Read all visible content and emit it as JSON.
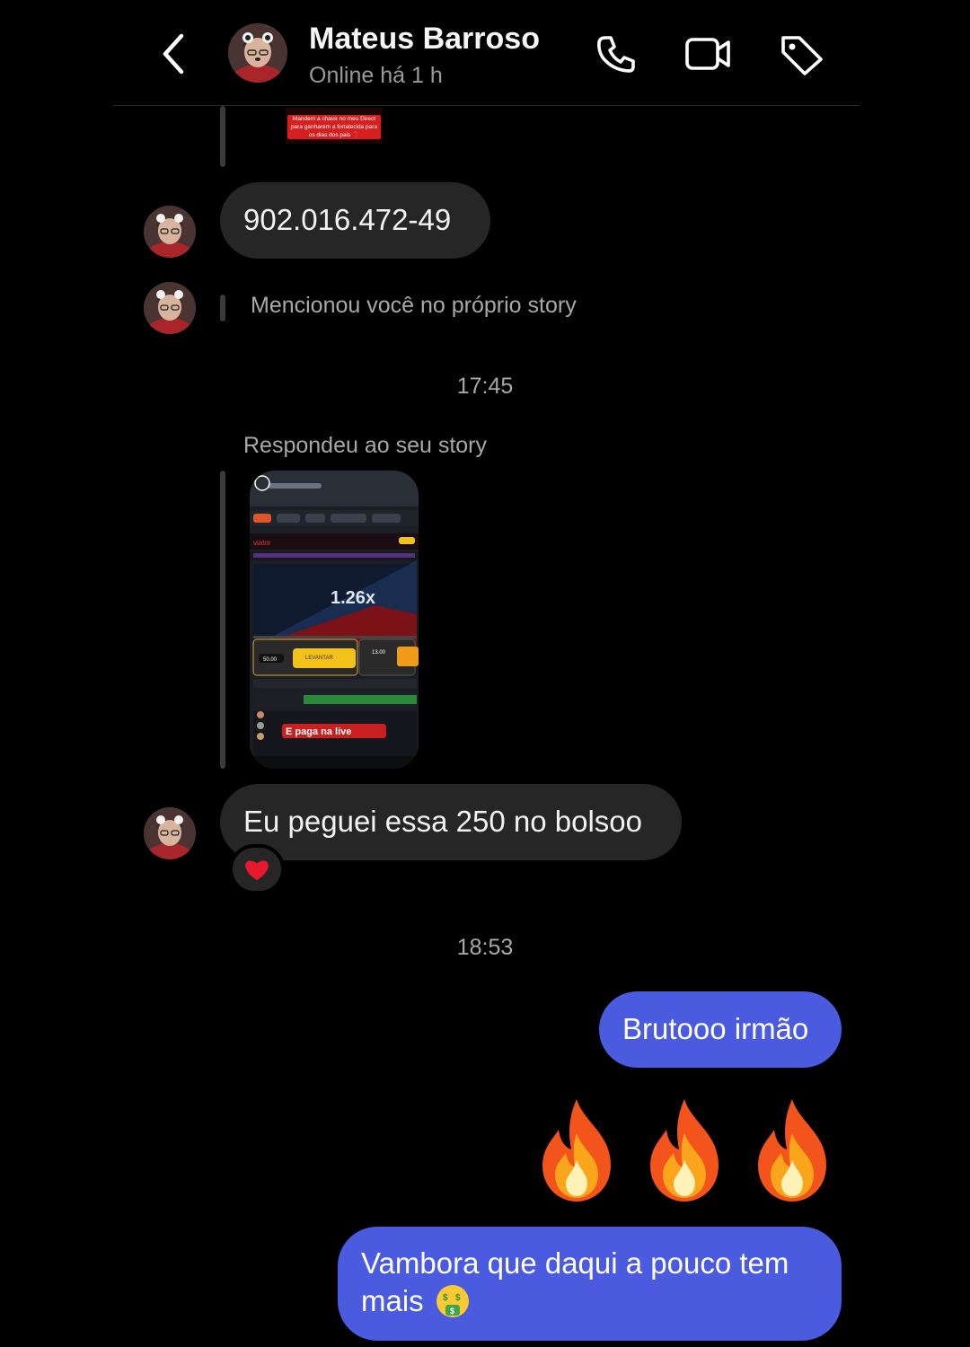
{
  "header": {
    "back_icon": "chevron-left-icon",
    "contact_name": "Mateus Barroso",
    "status": "Online há 1 h",
    "actions": [
      "phone-icon",
      "video-camera-icon",
      "tag-icon"
    ]
  },
  "messages": {
    "story_snippet_text": "Mandem a chave no meu Direct para ganharem a fortalecida para os dias dos pais ❓",
    "cpf_message": "902.016.472-49",
    "mention_text": "Mencionou você no próprio story",
    "time_1": "17:45",
    "replied_label": "Respondeu ao seu story",
    "story_thumb": {
      "multiplier": "1.26x",
      "caption": "E paga na live",
      "bet_left": "50.00",
      "bet_right": "13.00",
      "cashout_label": "LEVANTAR"
    },
    "reply_message": "Eu peguei essa 250 no bolsoo",
    "reaction_emoji": "❤️",
    "time_2": "18:53",
    "outgoing_1": "Brutooo irmão",
    "outgoing_emojis": "🔥🔥🔥",
    "outgoing_2_line1": "Vambora que daqui a pouco tem",
    "outgoing_2_line2": "mais"
  },
  "colors": {
    "background": "#000000",
    "incoming_bubble": "#262626",
    "outgoing_bubble": "#4a5be0",
    "secondary_text": "#a8a8a8"
  }
}
